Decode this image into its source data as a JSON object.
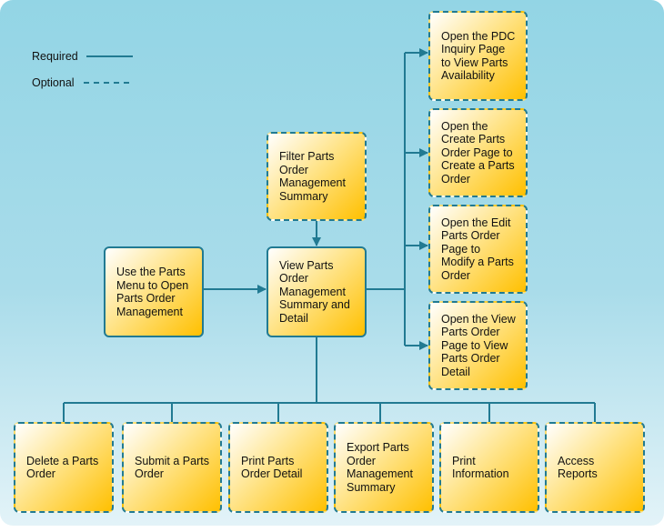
{
  "legend": {
    "required": "Required",
    "optional": "Optional"
  },
  "colors": {
    "line": "#217a92",
    "box_start": "#ffffff",
    "box_end": "#ffc000",
    "background": "#93d5e5"
  },
  "nodes": {
    "use_menu": "Use the Parts Menu to Open Parts Order Management",
    "filter": "Filter Parts Order Management Summary",
    "view": "View Parts Order Management Summary and Detail",
    "pdc": "Open the PDC Inquiry Page to View Parts Availability",
    "create": "Open the Create Parts Order Page to Create a Parts Order",
    "edit": "Open the Edit Parts Order Page to Modify a Parts Order",
    "view_order": "Open the View Parts Order Page to View Parts Order Detail",
    "delete": "Delete a Parts Order",
    "submit": "Submit a Parts Order",
    "print_detail": "Print Parts Order Detail",
    "export": "Export Parts Order Management Summary",
    "print_info": "Print Information",
    "reports": "Access Reports"
  }
}
